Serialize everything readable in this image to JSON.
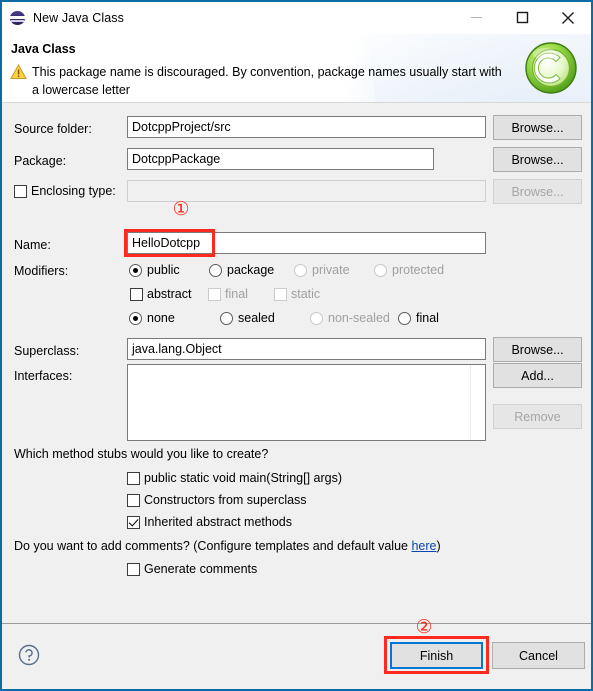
{
  "window": {
    "title": "New Java Class",
    "icon": "eclipse-sphere-icon",
    "minimize_label": "—",
    "maximize_label": "□",
    "close_label": "✕"
  },
  "header": {
    "title": "Java Class",
    "warning_icon": "warning-triangle-icon",
    "message": "This package name is discouraged. By convention, package names usually start with a lowercase letter",
    "badge_icon": "java-class-green-c-icon"
  },
  "form": {
    "source_folder": {
      "label": "Source folder:",
      "value": "DotcppProject/src",
      "button": "Browse...",
      "enabled": true
    },
    "package": {
      "label": "Package:",
      "value": "DotcppPackage",
      "button": "Browse...",
      "enabled": true
    },
    "enclosing_type": {
      "label": "Enclosing type:",
      "checked": false,
      "value": "",
      "button": "Browse...",
      "enabled": false
    },
    "name": {
      "label": "Name:",
      "value": "HelloDotcpp"
    },
    "modifiers": {
      "label": "Modifiers:",
      "access": [
        {
          "label": "public",
          "selected": true,
          "enabled": true
        },
        {
          "label": "package",
          "selected": false,
          "enabled": true
        },
        {
          "label": "private",
          "selected": false,
          "enabled": false
        },
        {
          "label": "protected",
          "selected": false,
          "enabled": false
        }
      ],
      "flags": [
        {
          "label": "abstract",
          "checked": false,
          "enabled": true
        },
        {
          "label": "final",
          "checked": false,
          "enabled": false
        },
        {
          "label": "static",
          "checked": false,
          "enabled": false
        }
      ],
      "sealed": [
        {
          "label": "none",
          "selected": true,
          "enabled": true
        },
        {
          "label": "sealed",
          "selected": false,
          "enabled": true
        },
        {
          "label": "non-sealed",
          "selected": false,
          "enabled": false
        },
        {
          "label": "final",
          "selected": false,
          "enabled": true
        }
      ]
    },
    "superclass": {
      "label": "Superclass:",
      "value": "java.lang.Object",
      "button": "Browse..."
    },
    "interfaces": {
      "label": "Interfaces:",
      "items": [],
      "add_button": "Add...",
      "remove_button": "Remove",
      "remove_enabled": false
    },
    "stubs": {
      "question": "Which method stubs would you like to create?",
      "options": [
        {
          "label": "public static void main(String[] args)",
          "checked": false
        },
        {
          "label": "Constructors from superclass",
          "checked": false
        },
        {
          "label": "Inherited abstract methods",
          "checked": true
        }
      ]
    },
    "comments": {
      "question_prefix": "Do you want to add comments? (Configure templates and default value ",
      "link": "here",
      "question_suffix": ")",
      "option": {
        "label": "Generate comments",
        "checked": false
      }
    }
  },
  "footer": {
    "help_icon": "help-question-icon",
    "finish_label": "Finish",
    "cancel_label": "Cancel"
  },
  "annotations": [
    {
      "number": "①",
      "target": "name-field"
    },
    {
      "number": "②",
      "target": "finish-button"
    }
  ],
  "colors": {
    "dialog_border": "#0a6ca0",
    "annotation_red": "#ff2a1f",
    "focus_blue": "#0078d7",
    "link_blue": "#0645ad",
    "panel_bg": "#f0f0f0"
  }
}
